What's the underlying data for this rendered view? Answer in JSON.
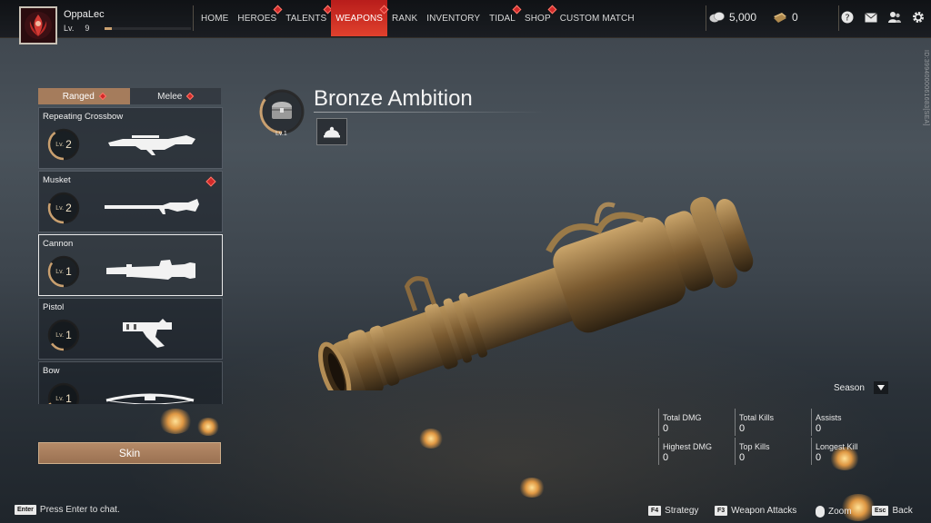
{
  "player": {
    "name": "OppaLec",
    "level_label": "Lv.",
    "level": "9",
    "xp_fraction": 0.08
  },
  "nav": {
    "items": [
      {
        "label": "HOME",
        "active": false,
        "alert": false
      },
      {
        "label": "HEROES",
        "active": false,
        "alert": true
      },
      {
        "label": "TALENTS",
        "active": false,
        "alert": true
      },
      {
        "label": "WEAPONS",
        "active": true,
        "alert": true
      },
      {
        "label": "RANK",
        "active": false,
        "alert": false
      },
      {
        "label": "INVENTORY",
        "active": false,
        "alert": false
      },
      {
        "label": "TIDAL",
        "active": false,
        "alert": true
      },
      {
        "label": "SHOP",
        "active": false,
        "alert": true
      },
      {
        "label": "CUSTOM MATCH",
        "active": false,
        "alert": false
      }
    ]
  },
  "currency": {
    "coins": "5,000",
    "tickets": "0"
  },
  "top_icons": [
    "help-icon",
    "mail-icon",
    "friends-icon",
    "settings-icon"
  ],
  "mode_tabs": {
    "ranged": "Ranged",
    "melee": "Melee"
  },
  "weapons": [
    {
      "name": "Repeating Crossbow",
      "lv_label": "Lv.",
      "level": "2",
      "progress": 0.4,
      "alert": false,
      "selected": false,
      "icon": "repeating-crossbow-icon"
    },
    {
      "name": "Musket",
      "lv_label": "Lv.",
      "level": "2",
      "progress": 0.3,
      "alert": true,
      "selected": false,
      "icon": "musket-icon"
    },
    {
      "name": "Cannon",
      "lv_label": "Lv.",
      "level": "1",
      "progress": 0.35,
      "alert": false,
      "selected": true,
      "icon": "cannon-icon"
    },
    {
      "name": "Pistol",
      "lv_label": "Lv.",
      "level": "1",
      "progress": 0.15,
      "alert": false,
      "selected": false,
      "icon": "pistol-icon"
    },
    {
      "name": "Bow",
      "lv_label": "Lv.",
      "level": "1",
      "progress": 0.2,
      "alert": false,
      "selected": false,
      "icon": "bow-icon"
    }
  ],
  "skin_button": "Skin",
  "weapon_detail": {
    "title": "Bronze Ambition",
    "level": "Lv.1",
    "level_progress": 0.35,
    "side_id": "ID:3994000061683[SEA]"
  },
  "season": {
    "label": "Season"
  },
  "stats": [
    {
      "label": "Total DMG",
      "value": "0"
    },
    {
      "label": "Total Kills",
      "value": "0"
    },
    {
      "label": "Assists",
      "value": "0"
    },
    {
      "label": "Highest DMG",
      "value": "0"
    },
    {
      "label": "Top Kills",
      "value": "0"
    },
    {
      "label": "Longest Kill",
      "value": "0"
    }
  ],
  "chat": {
    "key": "Enter",
    "text": "Press Enter to chat."
  },
  "hotkeys": [
    {
      "key": "F4",
      "label": "Strategy"
    },
    {
      "key": "F3",
      "label": "Weapon Attacks"
    },
    {
      "key": "mouse",
      "label": "Zoom"
    },
    {
      "key": "Esc",
      "label": "Back"
    }
  ],
  "colors": {
    "accent_red": "#d8302a",
    "tab_active": "#a57c5c",
    "bronze": "#8a6a3e"
  }
}
